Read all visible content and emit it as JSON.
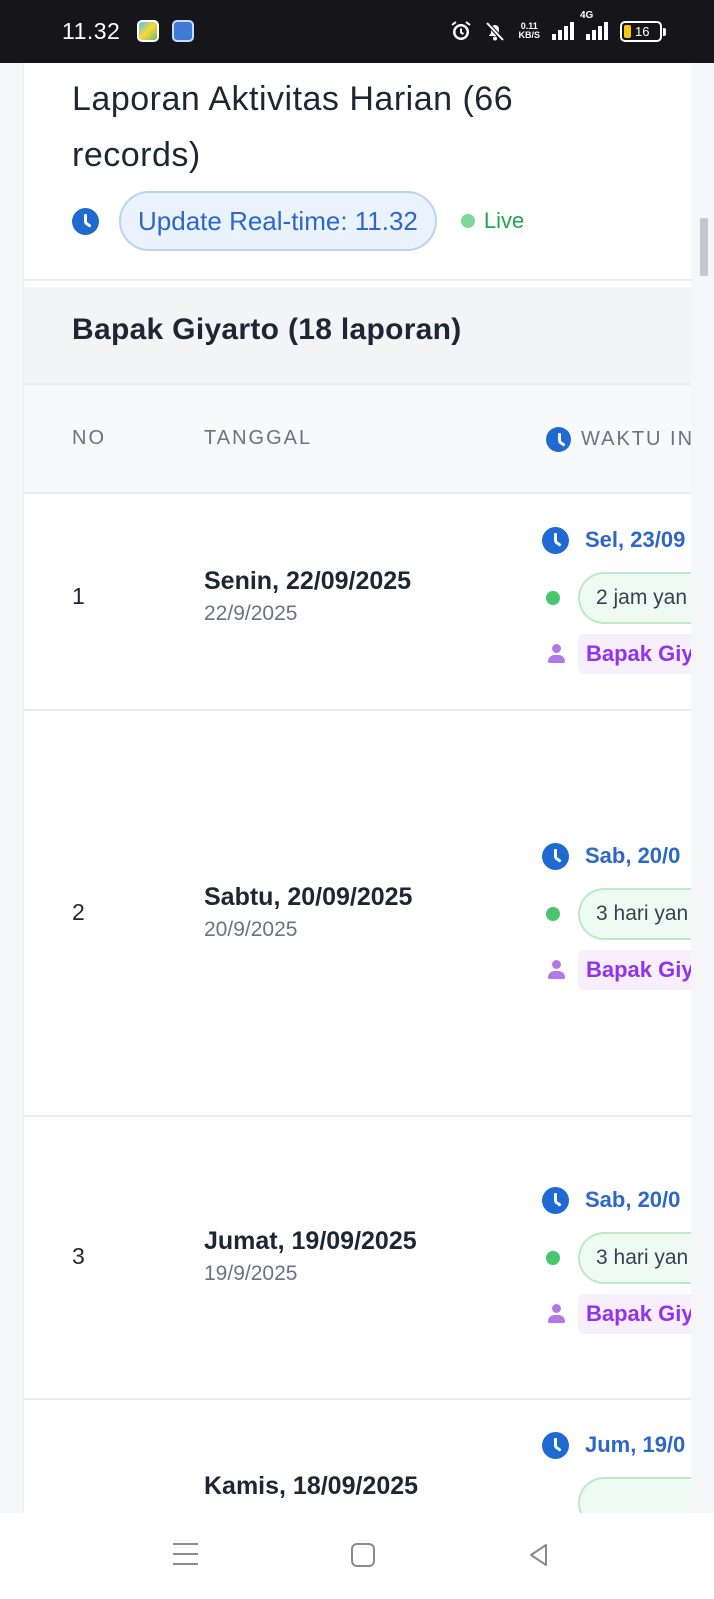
{
  "status_bar": {
    "time": "11.32",
    "net_speed_value": "0.11",
    "net_speed_unit": "KB/S",
    "network_type": "4G",
    "battery": "16"
  },
  "header": {
    "title": "Laporan Aktivitas Harian (66 records)",
    "update_label": "Update Real-time: 11.32",
    "live_label": "Live"
  },
  "group": {
    "title": "Bapak Giyarto (18 laporan)"
  },
  "table": {
    "columns": [
      "NO",
      "TANGGAL",
      "WAKTU IN"
    ],
    "rows": [
      {
        "no": "1",
        "date_main": "Senin, 22/09/2025",
        "date_sub": "22/9/2025",
        "time_date": "Sel, 23/09",
        "relative": "2 jam yan",
        "user": "Bapak Giya"
      },
      {
        "no": "2",
        "date_main": "Sabtu, 20/09/2025",
        "date_sub": "20/9/2025",
        "time_date": "Sab, 20/0",
        "relative": "3 hari yan",
        "user": "Bapak Giya"
      },
      {
        "no": "3",
        "date_main": "Jumat, 19/09/2025",
        "date_sub": "19/9/2025",
        "time_date": "Sab, 20/0",
        "relative": "3 hari yan",
        "user": "Bapak Giya"
      },
      {
        "no": "",
        "date_main": "Kamis, 18/09/2025",
        "date_sub": "",
        "time_date": "Jum, 19/0",
        "relative": "",
        "user": ""
      }
    ]
  },
  "colors": {
    "accent_blue": "#2d67c7",
    "live_green": "#23a64f",
    "user_purple": "#9333ea"
  }
}
